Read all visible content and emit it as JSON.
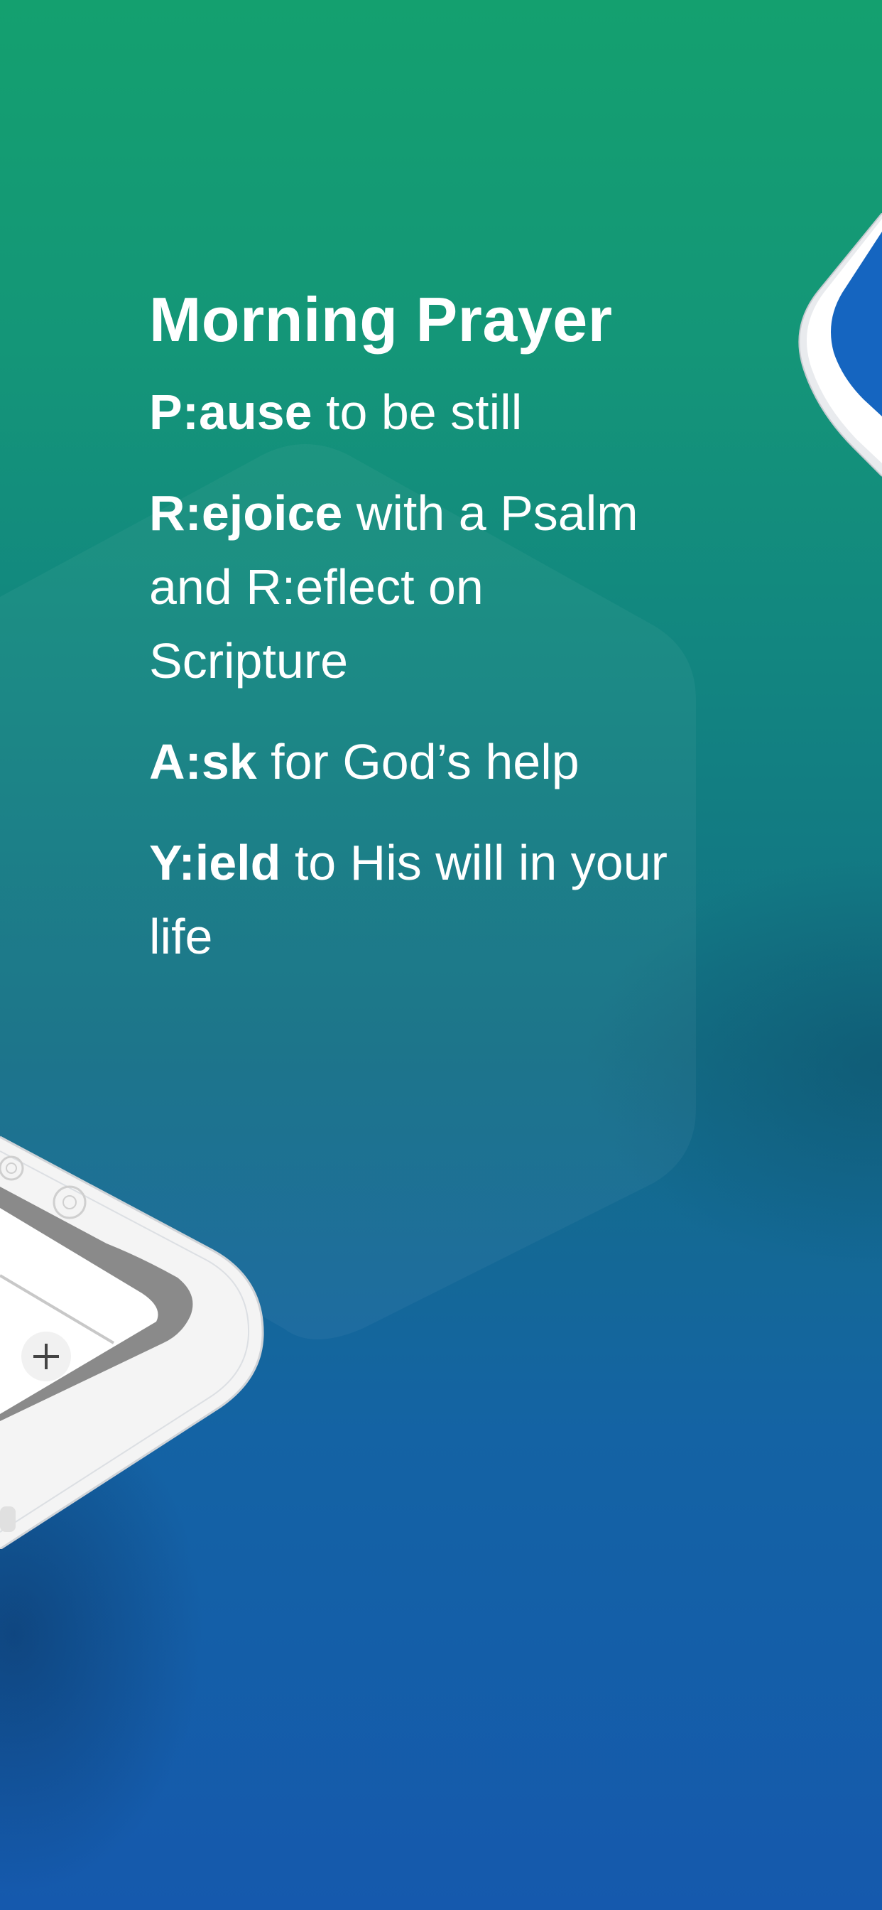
{
  "title": "Morning Prayer",
  "steps": [
    {
      "key": "P:ause",
      "rest": " to be still"
    },
    {
      "key": "R:ejoice",
      "rest": " with a Psalm and R:eflect on Scripture"
    },
    {
      "key": "A:sk",
      "rest": " for God’s help"
    },
    {
      "key": "Y:ield",
      "rest": " to His will in your life"
    }
  ],
  "icons": {
    "add": "plus-icon"
  },
  "colors": {
    "gradient_top": "#14a06f",
    "gradient_bottom": "#1559ad",
    "text": "#ffffff",
    "phone_body": "#f4f4f4",
    "phone_screen_blue": "#1565c0"
  }
}
